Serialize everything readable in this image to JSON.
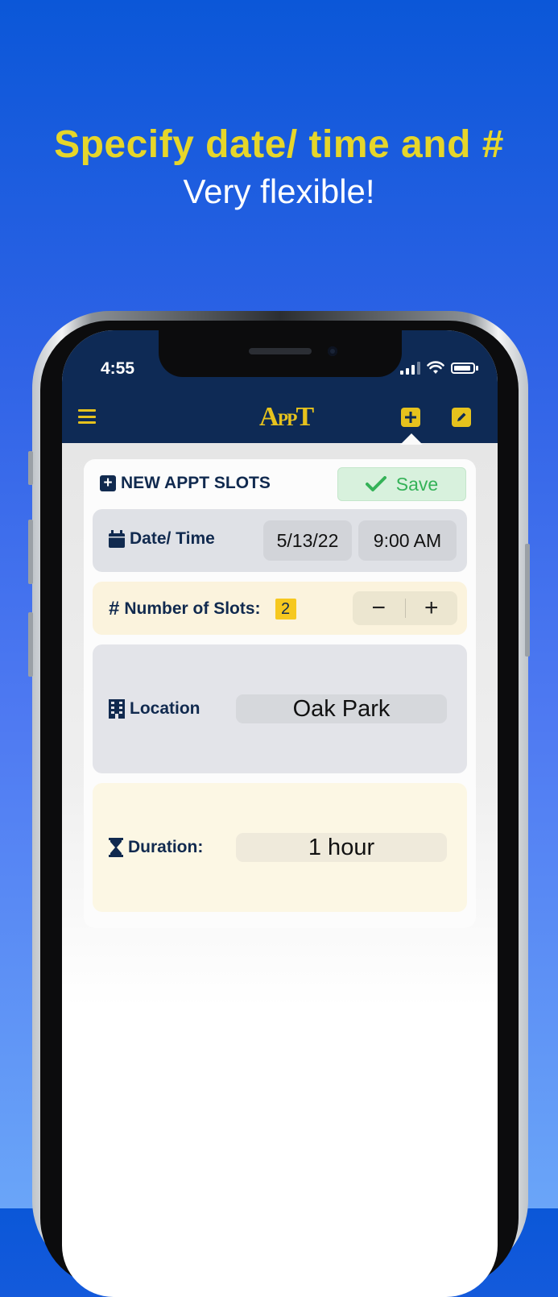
{
  "promo": {
    "headline": "Specify date/ time and #",
    "subline": "Very flexible!"
  },
  "status_bar": {
    "time": "4:55"
  },
  "app_bar": {
    "logo_main": "A",
    "logo_pp": "PP",
    "logo_t": "T",
    "menu_icon": "menu-icon",
    "add_icon": "plus-square-icon",
    "edit_icon": "pencil-square-icon",
    "accent_color": "#e6c21d",
    "bar_color": "#0e2a55"
  },
  "form": {
    "title": "NEW APPT SLOTS",
    "save_label": "Save",
    "datetime": {
      "label": "Date/ Time",
      "date": "5/13/22",
      "time": "9:00 AM"
    },
    "slots": {
      "label": "Number of Slots:",
      "value": "2",
      "minus": "−",
      "plus": "+"
    },
    "location": {
      "label": "Location",
      "value": "Oak Park"
    },
    "duration": {
      "label": "Duration:",
      "value": "1 hour"
    }
  }
}
